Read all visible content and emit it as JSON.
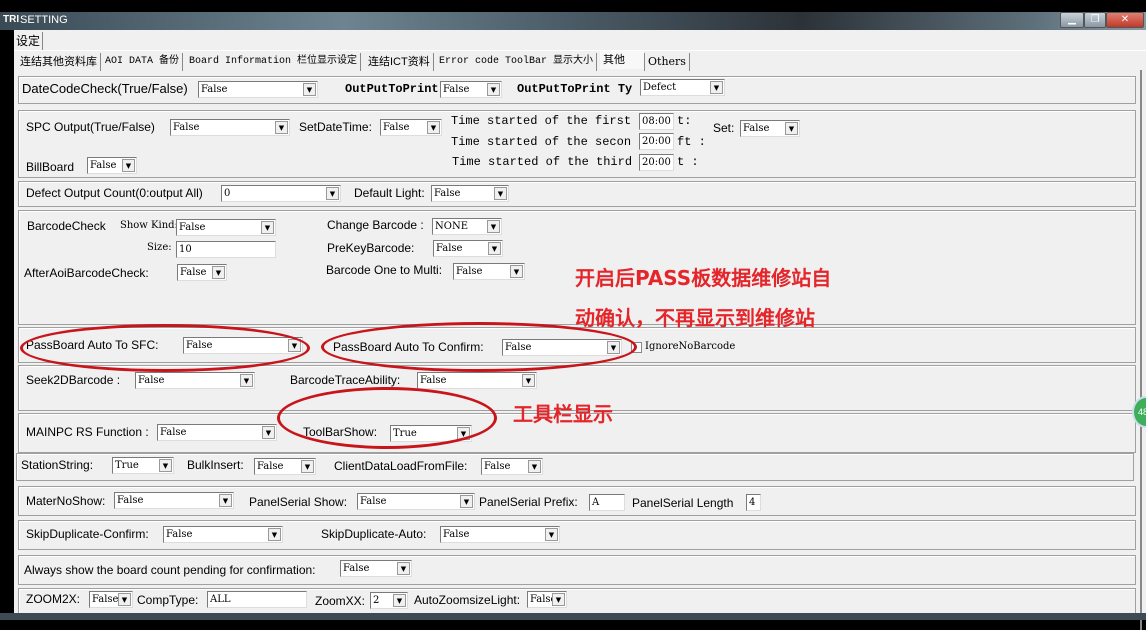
{
  "window": {
    "title": "SETTING",
    "logo": "TRI",
    "main_tab": "设定"
  },
  "tabs": [
    "连结其他资料库",
    "AOI DATA 备份",
    "Board Information 栏位显示设定",
    "连结ICT资料",
    "Error code ToolBar 显示大小",
    "其他",
    "Others"
  ],
  "g1": {
    "datecode_label": "DateCodeCheck(True/False)",
    "datecode_value": "False",
    "outprint_label": "OutPutToPrint",
    "outprint_value": "False",
    "outprinttype_label": "OutPutToPrint Ty",
    "outprinttype_value": "Defect"
  },
  "g2": {
    "spc_label": "SPC Output(True/False)",
    "spc_value": "False",
    "setdate_label": "SetDateTime:",
    "setdate_value": "False",
    "first_label": "Time started of the first",
    "first_value": "08:00",
    "first_suffix": "t:",
    "second_label": "Time started of the secon",
    "second_value": "20:00",
    "second_suffix": "ft :",
    "third_label": "Time started of the third",
    "third_value": "20:00",
    "third_suffix": "t :",
    "set_label": "Set:",
    "set_value": "False",
    "billboard_label": "BillBoard",
    "billboard_value": "False"
  },
  "g3": {
    "defect_label": "Defect Output Count(0:output All)",
    "defect_value": "0",
    "light_label": "Default Light:",
    "light_value": "False"
  },
  "g4": {
    "barcode_label": "BarcodeCheck",
    "showkind_label": "Show Kind:",
    "showkind_value": "False",
    "size_label": "Size:",
    "size_value": "10",
    "afteraoi_label": "AfterAoiBarcodeCheck:",
    "afteraoi_value": "False",
    "change_label": "Change Barcode :",
    "change_value": "NONE",
    "prekey_label": "PreKeyBarcode:",
    "prekey_value": "False",
    "onemulti_label": "Barcode One to Multi:",
    "onemulti_value": "False"
  },
  "g5": {
    "sfc_label": "PassBoard Auto To SFC:",
    "sfc_value": "False",
    "confirm_label": "PassBoard Auto To Confirm:",
    "confirm_value": "False",
    "ignore_label": "IgnoreNoBarcode",
    "ignore_checked": false
  },
  "g6": {
    "seek_label": "Seek2DBarcode :",
    "seek_value": "False",
    "trace_label": "BarcodeTraceAbility:",
    "trace_value": "False"
  },
  "g7": {
    "mainpc_label": "MAINPC RS Function :",
    "mainpc_value": "False",
    "toolbar_label": "ToolBarShow:",
    "toolbar_value": "True"
  },
  "g8": {
    "station_label": "StationString:",
    "station_value": "True",
    "bulk_label": "BulkInsert:",
    "bulk_value": "False",
    "client_label": "ClientDataLoadFromFile:",
    "client_value": "False"
  },
  "g9": {
    "mater_label": "MaterNoShow:",
    "mater_value": "False",
    "pshow_label": "PanelSerial Show:",
    "pshow_value": "False",
    "prefix_label": "PanelSerial Prefix:",
    "prefix_value": "A",
    "length_label": "PanelSerial Length",
    "length_value": "4"
  },
  "g10": {
    "skipc_label": "SkipDuplicate-Confirm:",
    "skipc_value": "False",
    "skipa_label": "SkipDuplicate-Auto:",
    "skipa_value": "False"
  },
  "g11": {
    "always_label": "Always show the board count pending for confirmation:",
    "always_value": "False"
  },
  "g12": {
    "zoom2x_label": "ZOOM2X:",
    "zoom2x_value": "False",
    "comp_label": "CompType:",
    "comp_value": "ALL",
    "zoomxx_label": "ZoomXX:",
    "zoomxx_value": "2",
    "autozoom_label": "AutoZoomsizeLight:",
    "autozoom_value": "False"
  },
  "annotations": {
    "pass_line1": "开启后PASS板数据维修站自",
    "pass_line2": "动确认，不再显示到维修站",
    "toolbar": "工具栏显示",
    "color": "#e4262b"
  },
  "badge": "48"
}
